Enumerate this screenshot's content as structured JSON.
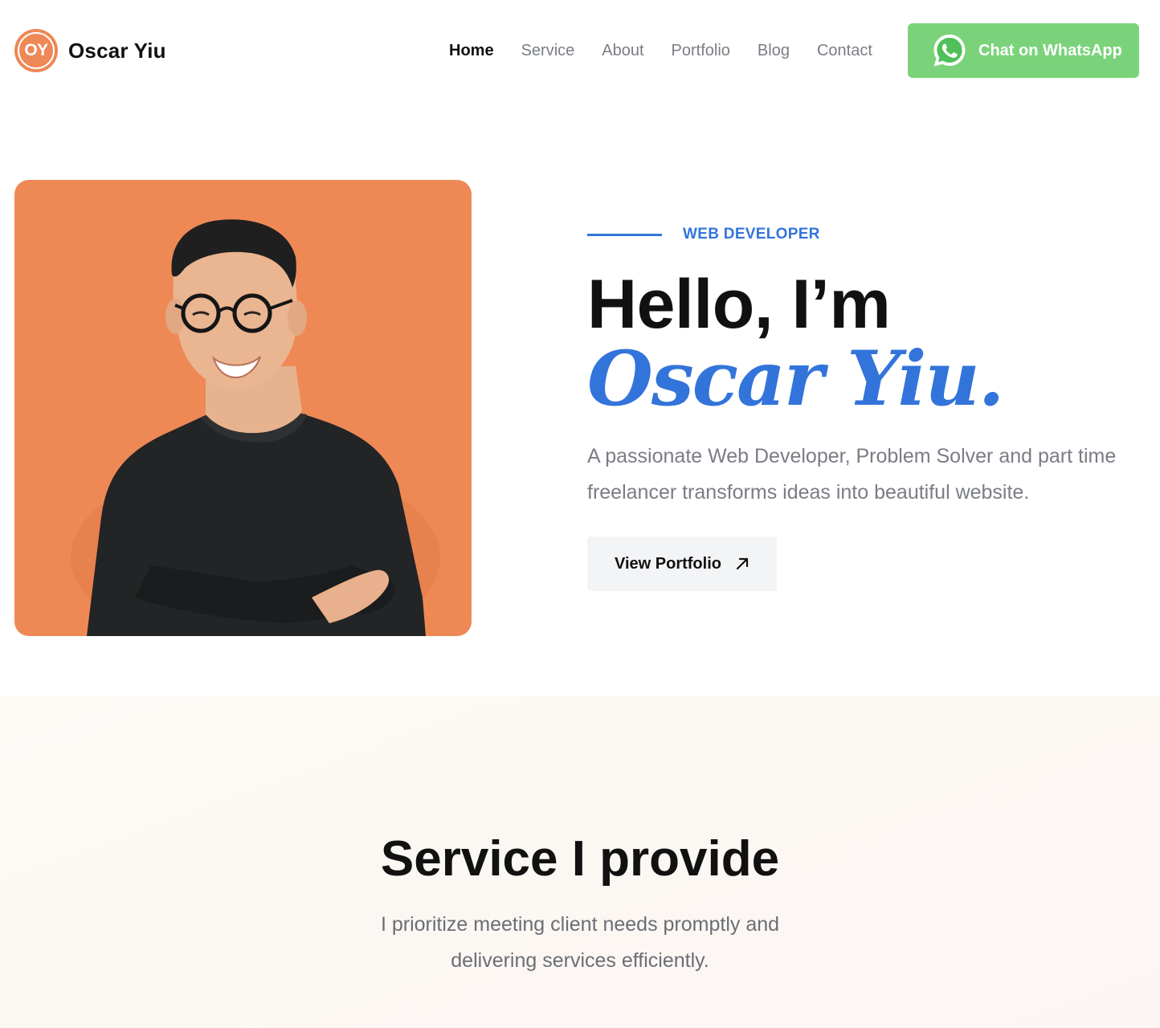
{
  "header": {
    "logo_initials": "OY",
    "logo_name": "Oscar Yiu",
    "nav": [
      {
        "label": "Home",
        "active": true
      },
      {
        "label": "Service",
        "active": false
      },
      {
        "label": "About",
        "active": false
      },
      {
        "label": "Portfolio",
        "active": false
      },
      {
        "label": "Blog",
        "active": false
      },
      {
        "label": "Contact",
        "active": false
      }
    ],
    "cta": {
      "label": "Chat on WhatsApp",
      "icon": "whatsapp-icon",
      "color": "#7ad37a"
    }
  },
  "hero": {
    "photo_bg": "#ee8956",
    "eyebrow": "WEB DEVELOPER",
    "greeting": "Hello, I’m",
    "name": "Oscar Yiu.",
    "intro": "A passionate Web Developer, Problem Solver and part time freelancer transforms ideas into beautiful website.",
    "button": {
      "label": "View Portfolio",
      "icon": "arrow-up-right-icon"
    }
  },
  "service": {
    "title": "Service I provide",
    "description": "I prioritize meeting client needs promptly and delivering services efficiently."
  },
  "colors": {
    "accent": "#3374db",
    "brand_orange": "#ee8856",
    "whatsapp_green": "#7ad37a"
  }
}
